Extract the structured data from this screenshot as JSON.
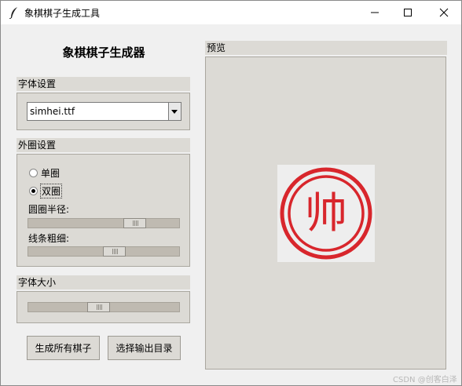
{
  "window": {
    "title": "象棋棋子生成工具",
    "icon": "feather-icon"
  },
  "app": {
    "heading": "象棋棋子生成器"
  },
  "font_group": {
    "label": "字体设置",
    "selected_font": "simhei.ttf"
  },
  "circle_group": {
    "label": "外圈设置",
    "options": [
      "单圈",
      "双圈"
    ],
    "selected": "双圈",
    "radius_label": "圆圈半径:",
    "radius_level": 0.74,
    "line_label": "线条粗细:",
    "line_level": 0.58
  },
  "size_group": {
    "label": "字体大小",
    "size_level": 0.46
  },
  "buttons": {
    "generate": "生成所有棋子",
    "choose_dir": "选择输出目录"
  },
  "preview": {
    "label": "预览",
    "piece_char": "帅",
    "piece_color": "#d8262c"
  },
  "watermark": "CSDN @创客白泽"
}
